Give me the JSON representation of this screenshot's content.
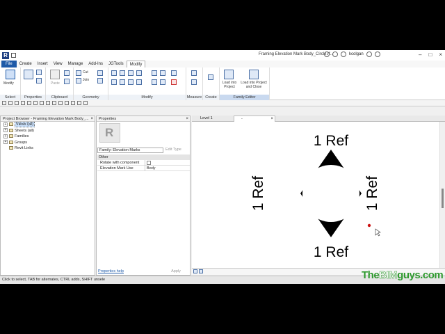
{
  "window": {
    "title": "Framing Elevation Mark Body_Circle.rf...",
    "user": "kcolgan"
  },
  "ribbon_tabs": [
    "File",
    "Create",
    "Insert",
    "View",
    "Manage",
    "Add-Ins",
    "JGTools",
    "Modify"
  ],
  "active_tab": "Modify",
  "ribbon": {
    "modify_label": "Modify",
    "paste_label": "Paste",
    "cut_label": "Cut",
    "join_label": "Join",
    "load_into_project": "Load into Project",
    "load_into_project_and_close": "Load into Project and Close",
    "panels": {
      "select": "Select",
      "properties": "Properties",
      "clipboard": "Clipboard",
      "geometry": "Geometry",
      "modify": "Modify",
      "measure": "Measure",
      "create": "Create",
      "family_editor": "Family Editor"
    }
  },
  "project_browser": {
    "title": "Project Browser - Framing Elevation Mark Body_...",
    "items": [
      {
        "label": "Views (all)",
        "selected": true
      },
      {
        "label": "Sheets (all)",
        "selected": false
      },
      {
        "label": "Families",
        "selected": false
      },
      {
        "label": "Groups",
        "selected": false
      },
      {
        "label": "Revit Links",
        "selected": false
      }
    ]
  },
  "properties": {
    "title": "Properties",
    "family_selector": "Family: Elevation Marks",
    "edit_type": "Edit Type",
    "group": "Other",
    "rows": [
      {
        "name": "Rotate with component",
        "value": ""
      },
      {
        "name": "Elevation Mark Use",
        "value": "Body"
      }
    ],
    "help_link": "Properties help",
    "apply": "Apply"
  },
  "view_tabs": [
    "Level 1",
    "-"
  ],
  "drawing": {
    "label_top": "1 Ref",
    "label_bottom": "1 Ref",
    "label_left": "1 Ref",
    "label_right": "1 Ref"
  },
  "status_bar": "Click to select, TAB for alternates, CTRL adds, SHIFT unsele",
  "watermark": {
    "the": "The",
    "bim": "BIM",
    "guys": "guys.com"
  },
  "colors": {
    "accent": "#1e5aa8",
    "watermark": "#2f9a2f",
    "marker": "#cc1111"
  }
}
